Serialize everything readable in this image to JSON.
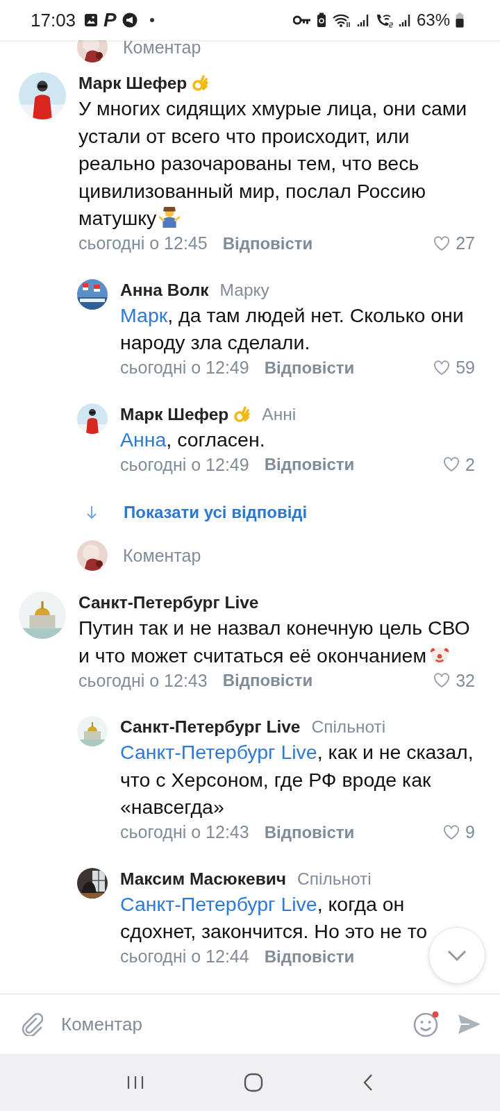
{
  "status_bar": {
    "time": "17:03",
    "app_glyph": "P",
    "battery": "63%"
  },
  "top_prompt": {
    "label": "Коментар"
  },
  "threads": [
    {
      "comment": {
        "author": "Марк Шефер",
        "author_emoji": {
          "kind": "ok-hand"
        },
        "text": "У многих сидящих хмурые лица, они сами устали от всего что происходит, или реально разочарованы тем, что весь цивилизованный мир, послал Россию матушку",
        "text_emoji": {
          "kind": "shrug"
        },
        "time": "сьогодні о 12:45",
        "reply_label": "Відповісти",
        "likes": "27"
      },
      "replies": [
        {
          "author": "Анна Волк",
          "addressee": "Марку",
          "mention": "Марк",
          "text": ", да там людей нет. Сколько они народу зла сделали.",
          "time": "сьогодні о 12:49",
          "reply_label": "Відповісти",
          "likes": "59"
        },
        {
          "author": "Марк Шефер",
          "author_emoji": {
            "kind": "ok-hand"
          },
          "addressee": "Анні",
          "mention": "Анна",
          "text": ", согласен.",
          "time": "сьогодні о 12:49",
          "reply_label": "Відповісти",
          "likes": "2"
        }
      ],
      "show_all": "Показати усі відповіді",
      "prompt": "Коментар"
    },
    {
      "comment": {
        "author": "Санкт-Петербург Live",
        "text": "Путин так и не назвал конечную цель СВО и что может считаться её окончанием",
        "text_emoji": {
          "kind": "clown"
        },
        "time": "сьогодні о 12:43",
        "reply_label": "Відповісти",
        "likes": "32"
      },
      "replies": [
        {
          "author": "Санкт-Петербург Live",
          "addressee": "Спільноті",
          "mention": "Санкт-Петербург Live",
          "text": ", как и не сказал, что с Херсоном, где РФ вроде как «навсегда»",
          "time": "сьогодні о 12:43",
          "reply_label": "Відповісти",
          "likes": "9"
        },
        {
          "author": "Максим Масюкевич",
          "addressee": "Спільноті",
          "mention": "Санкт-Петербург Live",
          "text": ", когда он сдохнет, закончится. Но это не то",
          "time": "сьогодні о 12:44",
          "reply_label": "Відповісти"
        }
      ]
    }
  ],
  "composer": {
    "placeholder": "Коментар"
  }
}
